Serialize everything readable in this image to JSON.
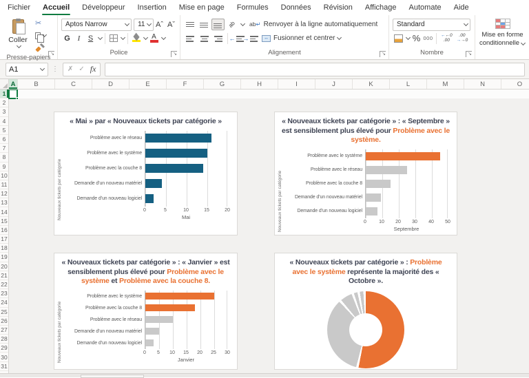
{
  "ribbon": {
    "tabs": [
      "Fichier",
      "Accueil",
      "Développeur",
      "Insertion",
      "Mise en page",
      "Formules",
      "Données",
      "Révision",
      "Affichage",
      "Automate",
      "Aide"
    ],
    "active_tab": "Accueil",
    "clipboard": {
      "paste": "Coller",
      "group": "Presse-papiers"
    },
    "font": {
      "family": "Aptos Narrow",
      "size": "11",
      "bold": "G",
      "italic": "I",
      "underline": "S",
      "grow": "A",
      "shrink": "A",
      "group": "Police"
    },
    "alignment": {
      "wrap": "Renvoyer à la ligne automatiquement",
      "merge": "Fusionner et centrer",
      "wrap_icon": "ab",
      "group": "Alignement"
    },
    "number": {
      "format": "Standard",
      "percent": "%",
      "thousands": "000",
      "dec_add_top": "←0",
      "dec_add_bottom": ".00",
      "dec_sub_top": ".00",
      "dec_sub_bottom": "→0",
      "group": "Nombre"
    },
    "styles": {
      "conditional_line1": "Mise en forme",
      "conditional_line2": "conditionnelle"
    }
  },
  "icons": {
    "scissors": "✂",
    "wrap_return": "↵",
    "merge_arrows": "↔",
    "launcher": "↘",
    "orientation": "ab",
    "cancel": "✗",
    "check": "✓",
    "fx": "fx",
    "dots": "⋮"
  },
  "formula_bar": {
    "name_box": "A1",
    "value": ""
  },
  "grid": {
    "columns": [
      "A",
      "B",
      "C",
      "D",
      "E",
      "F",
      "G",
      "H",
      "I",
      "J",
      "K",
      "L",
      "M",
      "N",
      "O"
    ],
    "selected_column": "A",
    "selected_row": 1,
    "rows_visible": 32
  },
  "colors": {
    "accent_blue": "#156082",
    "accent_orange": "#E97132",
    "bar_gray": "#C9C9C9",
    "selection_green": "#107C41",
    "title_text": "#3F4454"
  },
  "chart_data": [
    {
      "type": "bar",
      "title_segments": [
        {
          "text": "« Mai » par « Nouveaux tickets par catégorie »",
          "highlight": false
        }
      ],
      "ylabel": "Nouveaux tickets par catégorie",
      "xlabel": "Mai",
      "xmax": 20,
      "ticks": [
        0,
        5,
        10,
        15,
        20
      ],
      "categories": [
        "Problème avec le réseau",
        "Problème avec le système",
        "Problème avec la couche 8",
        "Demande d'un nouveau matériel",
        "Demande d'un nouveau logiciel"
      ],
      "values": [
        16,
        15,
        14,
        4,
        2
      ],
      "bar_colors": [
        "#156082",
        "#156082",
        "#156082",
        "#156082",
        "#156082"
      ]
    },
    {
      "type": "bar",
      "title_segments": [
        {
          "text": "« Nouveaux tickets par catégorie » : « Septembre » est sensiblement plus élevé pour ",
          "highlight": false
        },
        {
          "text": "Problème avec le système.",
          "highlight": true
        }
      ],
      "ylabel": "Nouveaux tickets par catégorie",
      "xlabel": "Septembre",
      "xmax": 50,
      "ticks": [
        0,
        10,
        20,
        30,
        40,
        50
      ],
      "categories": [
        "Problème avec le système",
        "Problème avec le réseau",
        "Problème avec la couche 8",
        "Demande d'un nouveau matériel",
        "Demande d'un nouveau logiciel"
      ],
      "values": [
        45,
        25,
        15,
        9,
        7
      ],
      "bar_colors": [
        "#E97132",
        "#C9C9C9",
        "#C9C9C9",
        "#C9C9C9",
        "#C9C9C9"
      ]
    },
    {
      "type": "bar",
      "title_segments": [
        {
          "text": "« Nouveaux tickets par catégorie » : « Janvier » est sensiblement plus élevé pour ",
          "highlight": false
        },
        {
          "text": "Problème avec le système",
          "highlight": true
        },
        {
          "text": " et ",
          "highlight": false
        },
        {
          "text": "Problème avec la couche 8.",
          "highlight": true
        }
      ],
      "ylabel": "Nouveaux tickets par catégorie",
      "xlabel": "Janvier",
      "xmax": 30,
      "ticks": [
        0,
        5,
        10,
        15,
        20,
        25,
        30
      ],
      "categories": [
        "Problème avec le système",
        "Problème avec la couche 8",
        "Problème avec le réseau",
        "Demande d'un nouveau matériel",
        "Demande d'un nouveau logiciel"
      ],
      "values": [
        25,
        18,
        10,
        5,
        3
      ],
      "bar_colors": [
        "#E97132",
        "#E97132",
        "#C9C9C9",
        "#C9C9C9",
        "#C9C9C9"
      ]
    },
    {
      "type": "donut",
      "title_segments": [
        {
          "text": "« Nouveaux tickets par catégorie » : ",
          "highlight": false
        },
        {
          "text": "Problème avec le système",
          "highlight": true
        },
        {
          "text": " représente la majorité des « Octobre ».",
          "highlight": false
        }
      ],
      "segments": [
        {
          "label": "Problème avec le système",
          "pct": 54,
          "color": "#E97132"
        },
        {
          "label": "",
          "pct": 35,
          "color": "#C9C9C9"
        },
        {
          "label": "",
          "pct": 6,
          "color": "#C9C9C9"
        },
        {
          "label": "",
          "pct": 2.5,
          "color": "#C9C9C9"
        },
        {
          "label": "",
          "pct": 2.5,
          "color": "#C9C9C9"
        }
      ]
    }
  ]
}
